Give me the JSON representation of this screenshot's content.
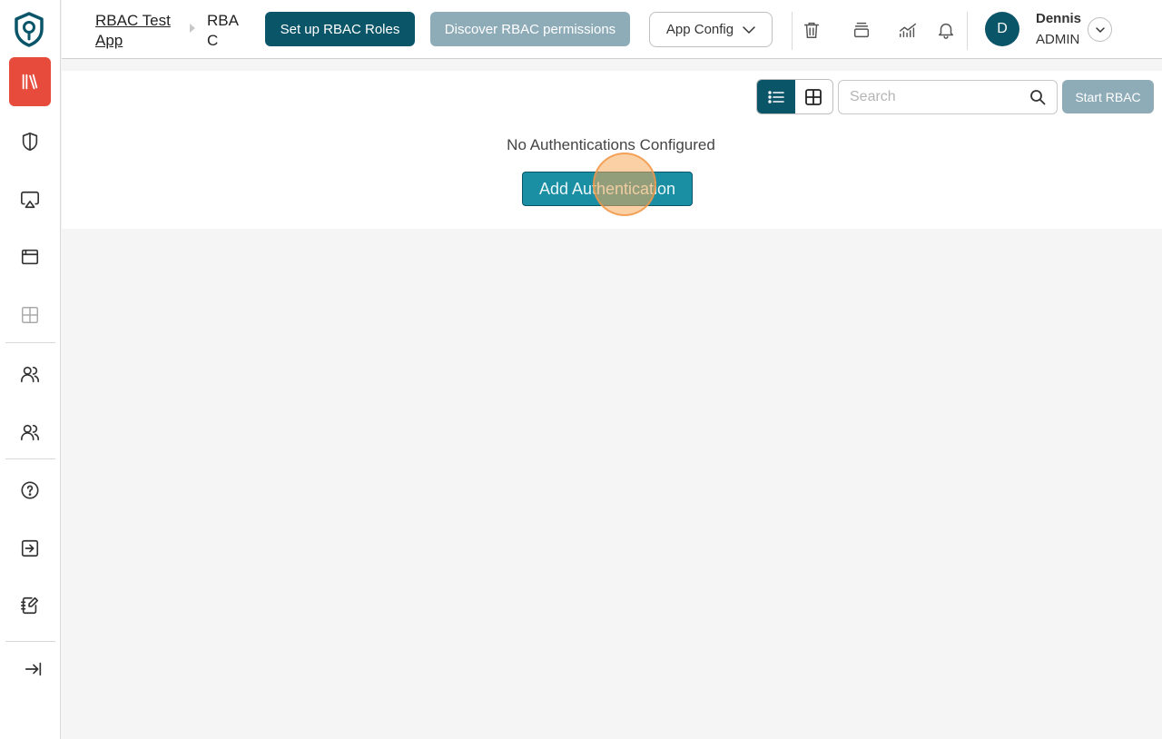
{
  "sidebar": {
    "items": [
      {
        "icon": "library-icon",
        "active": true
      },
      {
        "icon": "shield-icon"
      },
      {
        "icon": "airplay-icon"
      },
      {
        "icon": "browser-window-icon"
      },
      {
        "icon": "grid-icon"
      },
      {
        "icon": "users-icon"
      },
      {
        "icon": "team-icon"
      },
      {
        "icon": "help-circle-icon"
      },
      {
        "icon": "sign-in-icon"
      },
      {
        "icon": "notebook-edit-icon"
      },
      {
        "icon": "collapse-sidebar-icon"
      }
    ],
    "colors": {
      "active_bg": "#e64b3c",
      "brand": "#0b5569"
    }
  },
  "header": {
    "breadcrumb": {
      "parent": "RBAC Test App",
      "current": "RBAC"
    },
    "setup_roles_label": "Set up RBAC Roles",
    "discover_label": "Discover RBAC permissions",
    "app_config_label": "App Config",
    "icons": [
      "trash-icon",
      "layers-icon",
      "analytics-icon",
      "bell-icon"
    ],
    "user": {
      "initial": "D",
      "name": "Dennis",
      "role": "ADMIN"
    }
  },
  "main": {
    "search": {
      "placeholder": "Search",
      "value": ""
    },
    "start_label": "Start RBAC",
    "empty_message": "No Authentications Configured",
    "add_label": "Add Authentication",
    "view_mode": "list"
  }
}
